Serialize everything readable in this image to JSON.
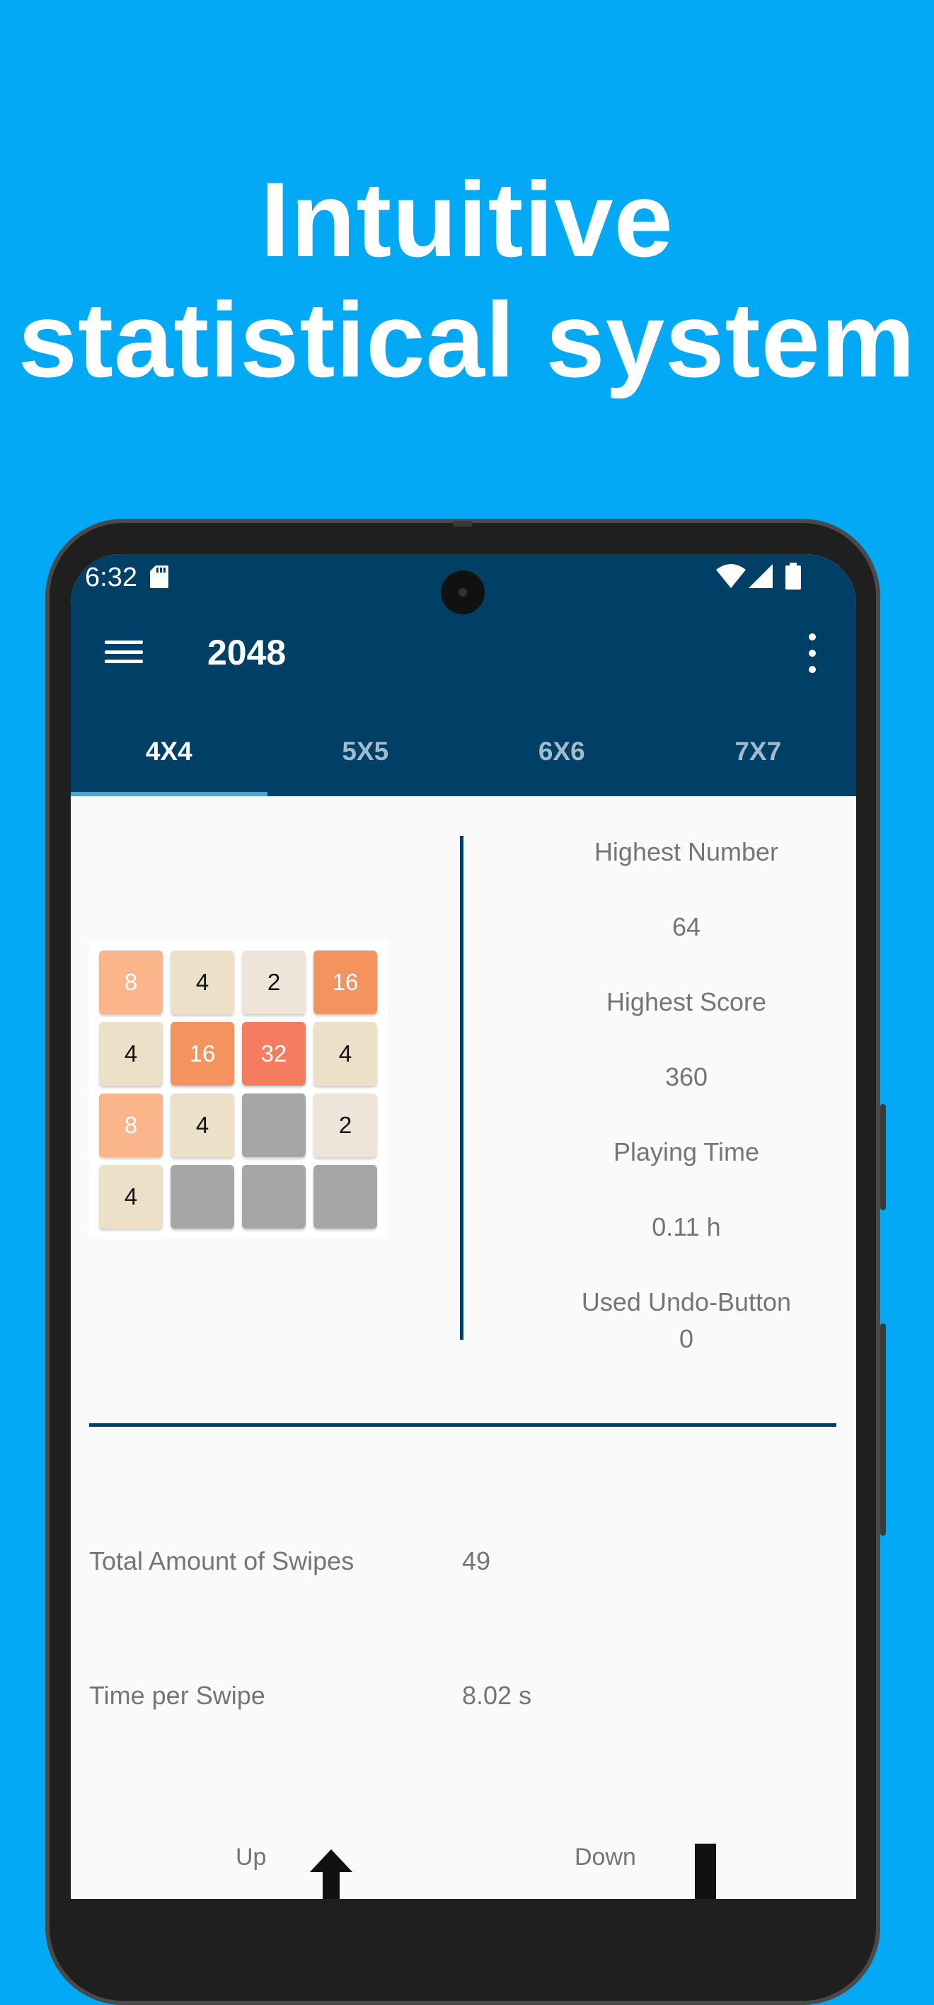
{
  "headline": {
    "line1": "Intuitive",
    "line2": "statistical system"
  },
  "status_bar": {
    "time": "6:32",
    "icons": [
      "sd-card-icon",
      "wifi-icon",
      "signal-icon",
      "battery-icon"
    ]
  },
  "toolbar": {
    "title": "2048",
    "menu_icon": "hamburger-menu-icon",
    "overflow_icon": "more-vert-icon"
  },
  "tabs": [
    {
      "label": "4X4",
      "active": true
    },
    {
      "label": "5X5",
      "active": false
    },
    {
      "label": "6X6",
      "active": false
    },
    {
      "label": "7X7",
      "active": false
    }
  ],
  "board": {
    "size": 4,
    "cells": [
      [
        "8",
        "4",
        "2",
        "16"
      ],
      [
        "4",
        "16",
        "32",
        "4"
      ],
      [
        "8",
        "4",
        "",
        "2"
      ],
      [
        "4",
        "",
        "",
        ""
      ]
    ],
    "tile_colors": {
      "": {
        "bg": "#A6A6A6",
        "fg": "#000000"
      },
      "2": {
        "bg": "#EEE4DA",
        "fg": "#111111"
      },
      "4": {
        "bg": "#EDE0C8",
        "fg": "#111111"
      },
      "8": {
        "bg": "#FBB58A",
        "fg": "#FFFFFF"
      },
      "16": {
        "bg": "#F4935E",
        "fg": "#FFFFFF"
      },
      "32": {
        "bg": "#F57C5F",
        "fg": "#FFFFFF"
      }
    }
  },
  "stats": {
    "highest_number_label": "Highest Number",
    "highest_number_value": "64",
    "highest_score_label": "Highest Score",
    "highest_score_value": "360",
    "playing_time_label": "Playing Time",
    "playing_time_value": "0.11 h",
    "undo_label": "Used Undo-Button",
    "undo_value": "0"
  },
  "details": {
    "swipes_label": "Total Amount of Swipes",
    "swipes_value": "49",
    "time_per_swipe_label": "Time per Swipe",
    "time_per_swipe_value": "8.02 s",
    "up_label": "Up",
    "down_label": "Down"
  },
  "colors": {
    "background": "#03A9F4",
    "appbar": "#003F66",
    "tab_indicator": "#4FA3DA"
  }
}
